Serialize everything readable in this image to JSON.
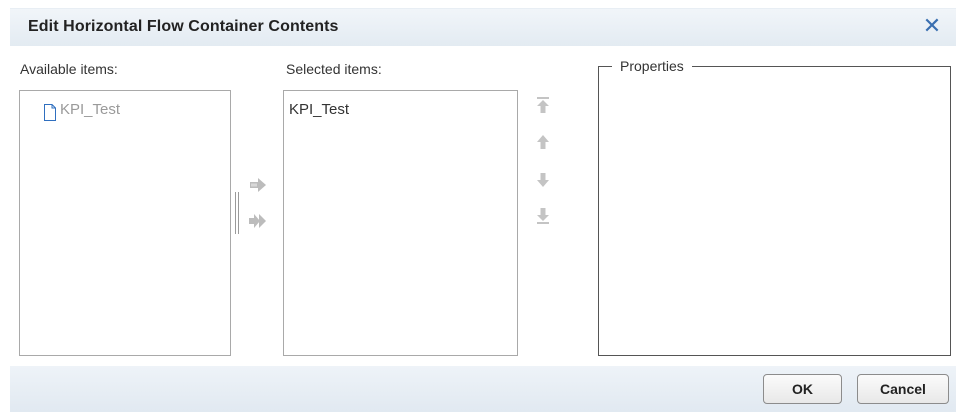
{
  "dialog": {
    "title": "Edit Horizontal Flow Container Contents",
    "close_icon": "close-icon",
    "accent_color": "#3a6fb0"
  },
  "available": {
    "label": "Available items:",
    "items": [
      {
        "label": "KPI_Test",
        "icon": "document-icon",
        "enabled": false
      }
    ]
  },
  "selected": {
    "label": "Selected items:",
    "items": [
      {
        "label": "KPI_Test"
      }
    ]
  },
  "transfer_buttons": [
    {
      "name": "add-item-button",
      "icon": "arrow-right-icon"
    },
    {
      "name": "add-all-items-button",
      "icon": "double-arrow-right-icon"
    }
  ],
  "order_buttons": [
    {
      "name": "move-to-top-button",
      "icon": "move-to-top-icon"
    },
    {
      "name": "move-up-button",
      "icon": "arrow-up-icon"
    },
    {
      "name": "move-down-button",
      "icon": "arrow-down-icon"
    },
    {
      "name": "move-to-bottom-button",
      "icon": "move-to-bottom-icon"
    }
  ],
  "properties": {
    "legend": "Properties"
  },
  "footer": {
    "ok_label": "OK",
    "cancel_label": "Cancel"
  }
}
